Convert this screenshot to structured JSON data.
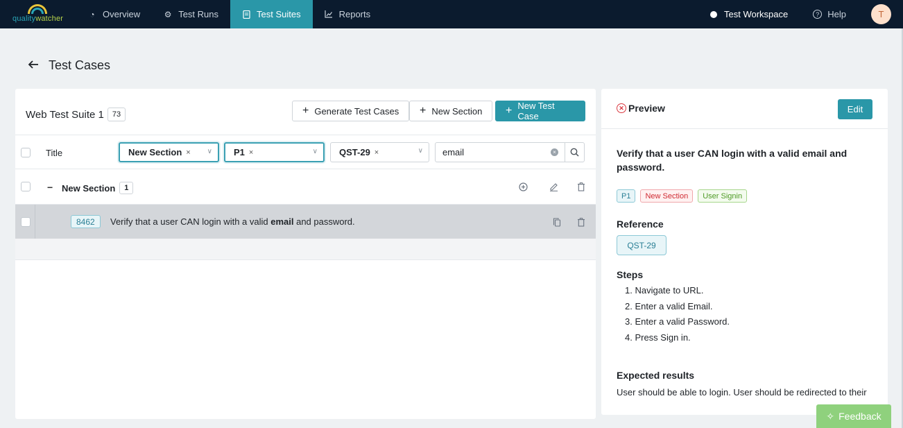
{
  "brand": {
    "logo_text_1": "quality",
    "logo_text_2": "watcher"
  },
  "nav": {
    "items": [
      {
        "label": "Overview",
        "icon": "pie-chart-icon"
      },
      {
        "label": "Test Runs",
        "icon": "gear-icon"
      },
      {
        "label": "Test Suites",
        "icon": "document-icon",
        "active": true
      },
      {
        "label": "Reports",
        "icon": "line-chart-icon"
      }
    ],
    "workspace": "Test Workspace",
    "help": "Help",
    "avatar_initial": "T"
  },
  "page": {
    "title": "Test Cases"
  },
  "suite": {
    "name": "Web Test Suite 1",
    "count": "73",
    "buttons": {
      "generate": "Generate Test Cases",
      "new_section": "New Section",
      "new_test_case": "New Test Case"
    }
  },
  "filters": {
    "title_header": "Title",
    "section": "New Section",
    "priority": "P1",
    "reference": "QST-29",
    "search_value": "email"
  },
  "section_row": {
    "name": "New Section",
    "count": "1"
  },
  "case_row": {
    "id": "8462",
    "text_before": "Verify that a user CAN login with a valid ",
    "highlight": "email",
    "text_after": " and password."
  },
  "preview": {
    "title": "Preview",
    "edit_label": "Edit",
    "case_title": "Verify that a user CAN login with a valid email and password.",
    "tags": [
      "P1",
      "New Section",
      "User Signin"
    ],
    "reference_label": "Reference",
    "reference": "QST-29",
    "steps_label": "Steps",
    "steps": [
      "1. Navigate to URL.",
      "2. Enter a valid Email.",
      "3. Enter a valid Password.",
      "4. Press Sign in."
    ],
    "expected_label": "Expected results",
    "expected_text": "User should be able to login. User should be redirected to their"
  },
  "feedback": {
    "label": "Feedback"
  },
  "colors": {
    "nav_bg": "#0b1b2e",
    "accent": "#2a97a8",
    "feedback": "#8fd17d",
    "danger": "#d9363e"
  }
}
